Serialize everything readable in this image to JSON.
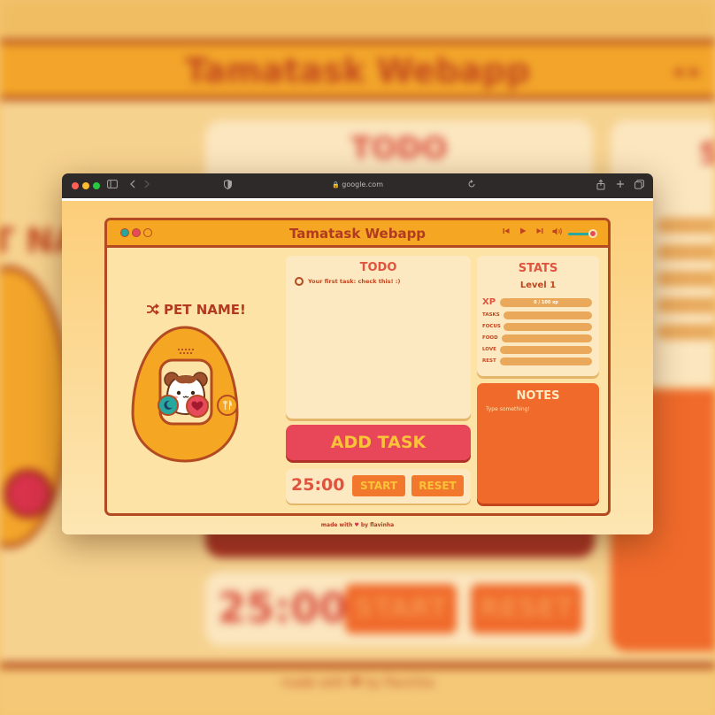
{
  "backdrop": {
    "title": "Tamatask Webapp",
    "controls": "◂ ▸",
    "todo_title": "TODO",
    "timer": "25:00",
    "start": "START",
    "reset": "RESET",
    "pet_name_fragment": "T NA",
    "stats_fragment": "S",
    "footer": "made with ♥ by flavinha"
  },
  "browser": {
    "url": "google.com",
    "colors": {
      "close": "#ff5f57",
      "minimize": "#febc2e",
      "maximize": "#28c840"
    },
    "icons": [
      "sidebar-icon",
      "back-icon",
      "forward-icon",
      "privacy-icon",
      "lock-icon",
      "reload-icon",
      "share-icon",
      "new-tab-icon",
      "tabs-overview-icon"
    ]
  },
  "app": {
    "title": "Tamatask Webapp",
    "window_dots": [
      "#27a79d",
      "#e64a5b",
      "#f5a623"
    ],
    "media": {
      "prev": "⏮",
      "play": "▶",
      "next": "⏭",
      "volume_icon": "🔊",
      "volume_level": 0.9
    },
    "pet": {
      "name": "PET NAME!",
      "buttons": [
        {
          "name": "sleep",
          "color": "#27a79d",
          "icon": "moon-icon"
        },
        {
          "name": "love",
          "color": "#d9324b",
          "icon": "heart-icon"
        },
        {
          "name": "feed",
          "color": "#f5a623",
          "icon": "fork-knife-icon"
        }
      ]
    },
    "todo": {
      "title": "TODO",
      "tasks": [
        {
          "text": "Your first task: check this! :)",
          "done": false
        }
      ]
    },
    "add_task_label": "ADD TASK",
    "timer": {
      "time": "25:00",
      "start_label": "START",
      "reset_label": "RESET"
    },
    "stats": {
      "title": "STATS",
      "level": "Level 1",
      "xp_label": "XP",
      "xp_text": "0 / 100 xp",
      "items": [
        {
          "label": "TASKS"
        },
        {
          "label": "FOCUS"
        },
        {
          "label": "FOOD"
        },
        {
          "label": "LOVE"
        },
        {
          "label": "REST"
        }
      ]
    },
    "notes": {
      "title": "NOTES",
      "placeholder": "Type something!"
    },
    "footer": {
      "prefix": "made with",
      "suffix": "by flavinha"
    }
  }
}
